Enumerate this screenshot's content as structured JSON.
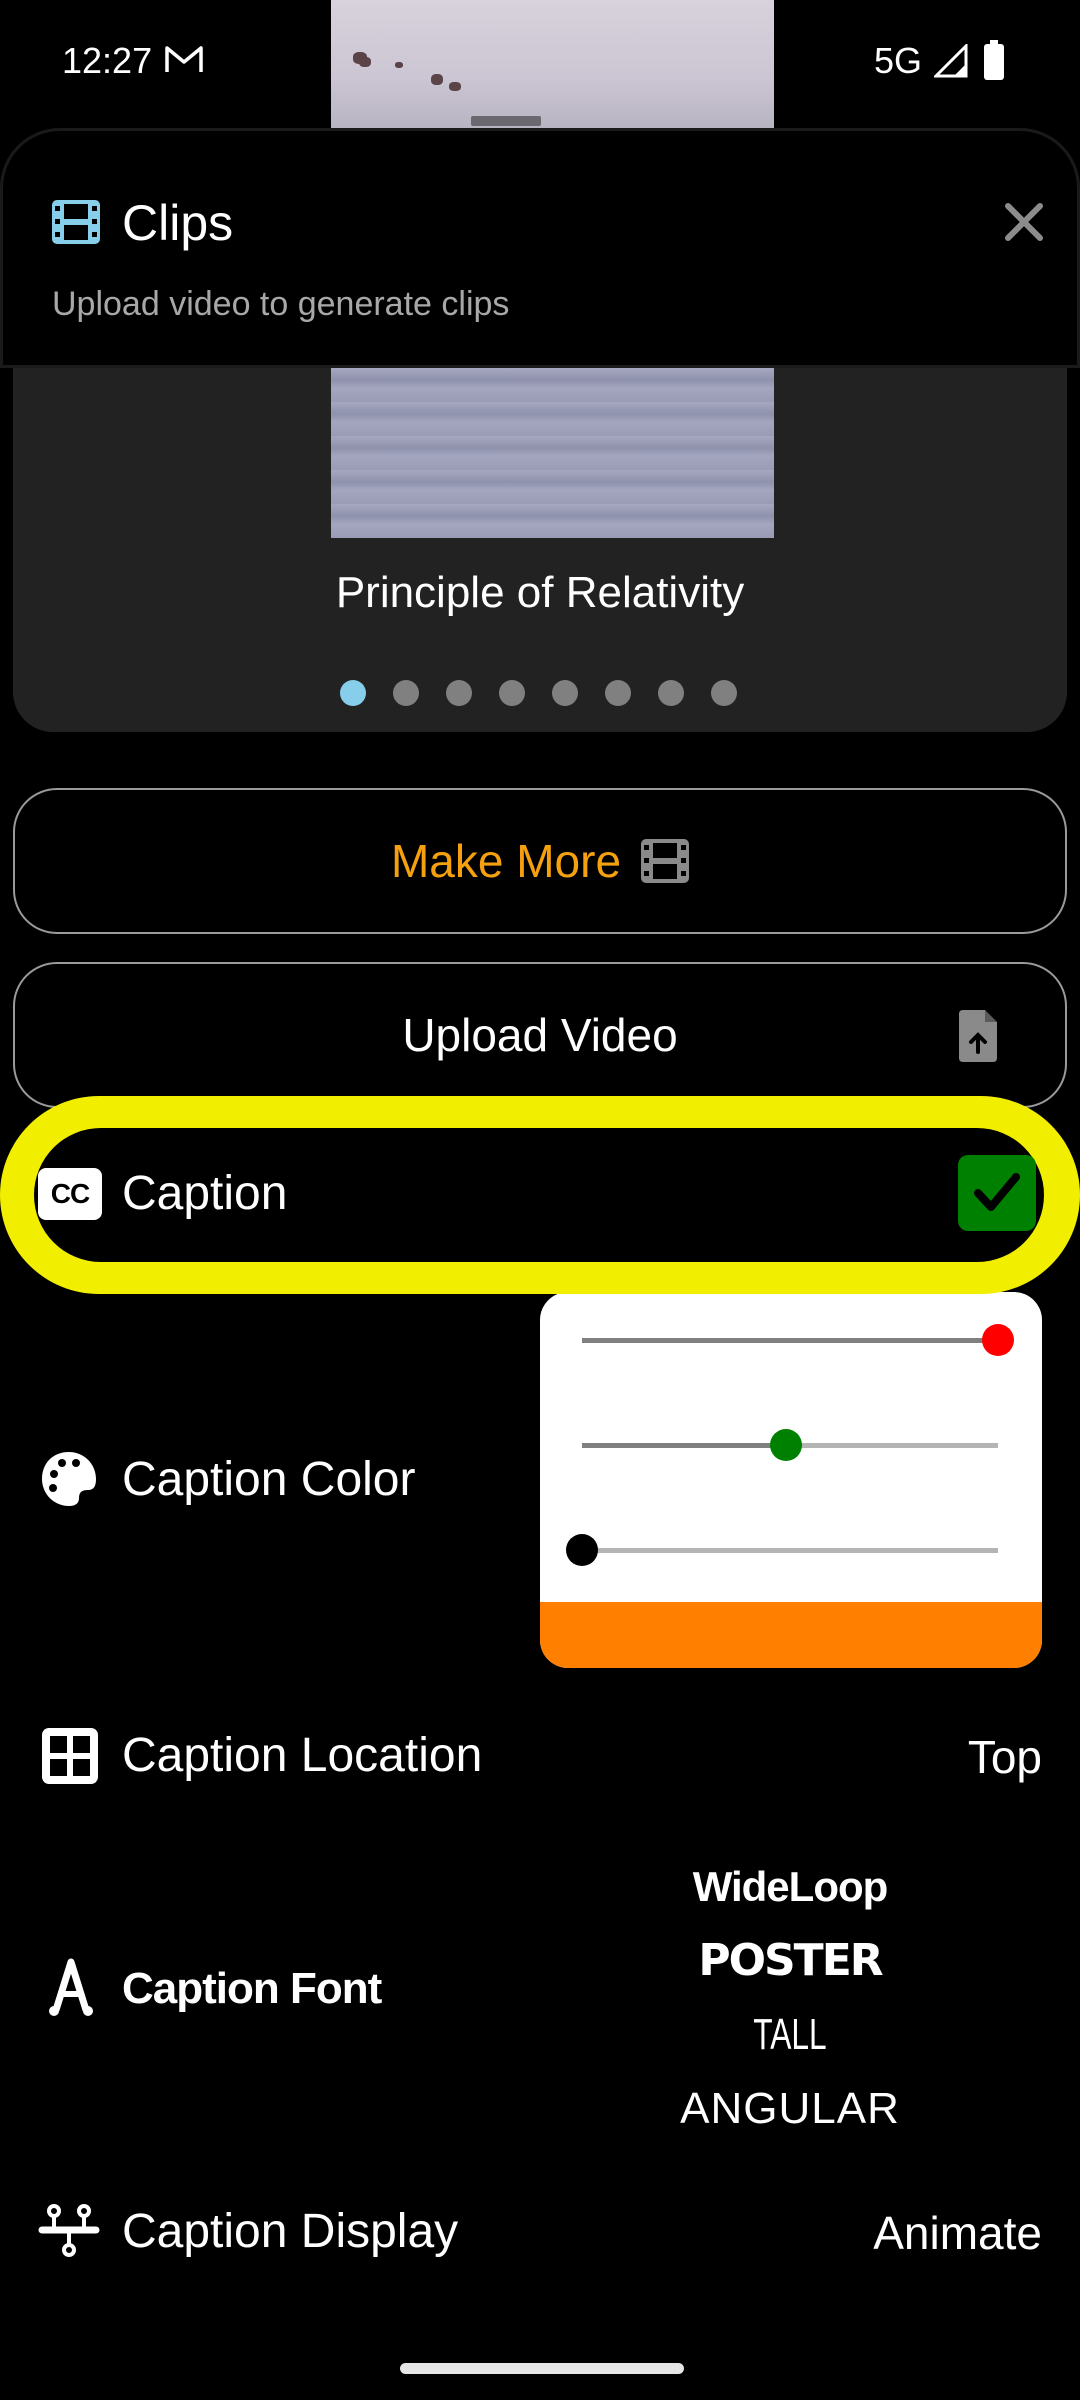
{
  "status_bar": {
    "time": "12:27",
    "notification_icon": "gmail-icon",
    "network": "5G",
    "signal_icon": "signal-icon",
    "battery_icon": "battery-icon"
  },
  "sheet": {
    "title": "Clips",
    "title_icon": "film-icon",
    "subtitle": "Upload video to generate clips",
    "close_icon": "close-icon"
  },
  "carousel": {
    "current_clip_title": "Principle of Relativity",
    "page_count": 8,
    "active_index": 0,
    "active_color": "#87ceeb",
    "inactive_color": "#808080"
  },
  "buttons": {
    "make_more": {
      "label": "Make More",
      "icon": "film-icon",
      "color": "#f5a00f"
    },
    "upload_video": {
      "label": "Upload Video",
      "icon": "file-upload-icon"
    }
  },
  "caption": {
    "label": "Caption",
    "icon": "closed-captions-icon",
    "enabled": true,
    "highlight_color": "#f2ee00",
    "check_color": "#008000"
  },
  "caption_color": {
    "label": "Caption Color",
    "icon": "palette-icon",
    "sliders": [
      {
        "channel": "red",
        "value": 255,
        "max": 255,
        "thumb_color": "#ff0000"
      },
      {
        "channel": "green",
        "value": 125,
        "max": 255,
        "thumb_color": "#008000"
      },
      {
        "channel": "blue",
        "value": 0,
        "max": 255,
        "thumb_color": "#000000"
      }
    ],
    "preview_color": "#ff7f00"
  },
  "caption_location": {
    "label": "Caption Location",
    "icon": "grid-icon",
    "value": "Top"
  },
  "caption_font": {
    "label": "Caption Font",
    "icon": "font-icon",
    "options": [
      "WideLoop",
      "POSTER",
      "TALL",
      "ANGULAR"
    ]
  },
  "caption_display": {
    "label": "Caption Display",
    "icon": "display-mode-icon",
    "value": "Animate"
  }
}
